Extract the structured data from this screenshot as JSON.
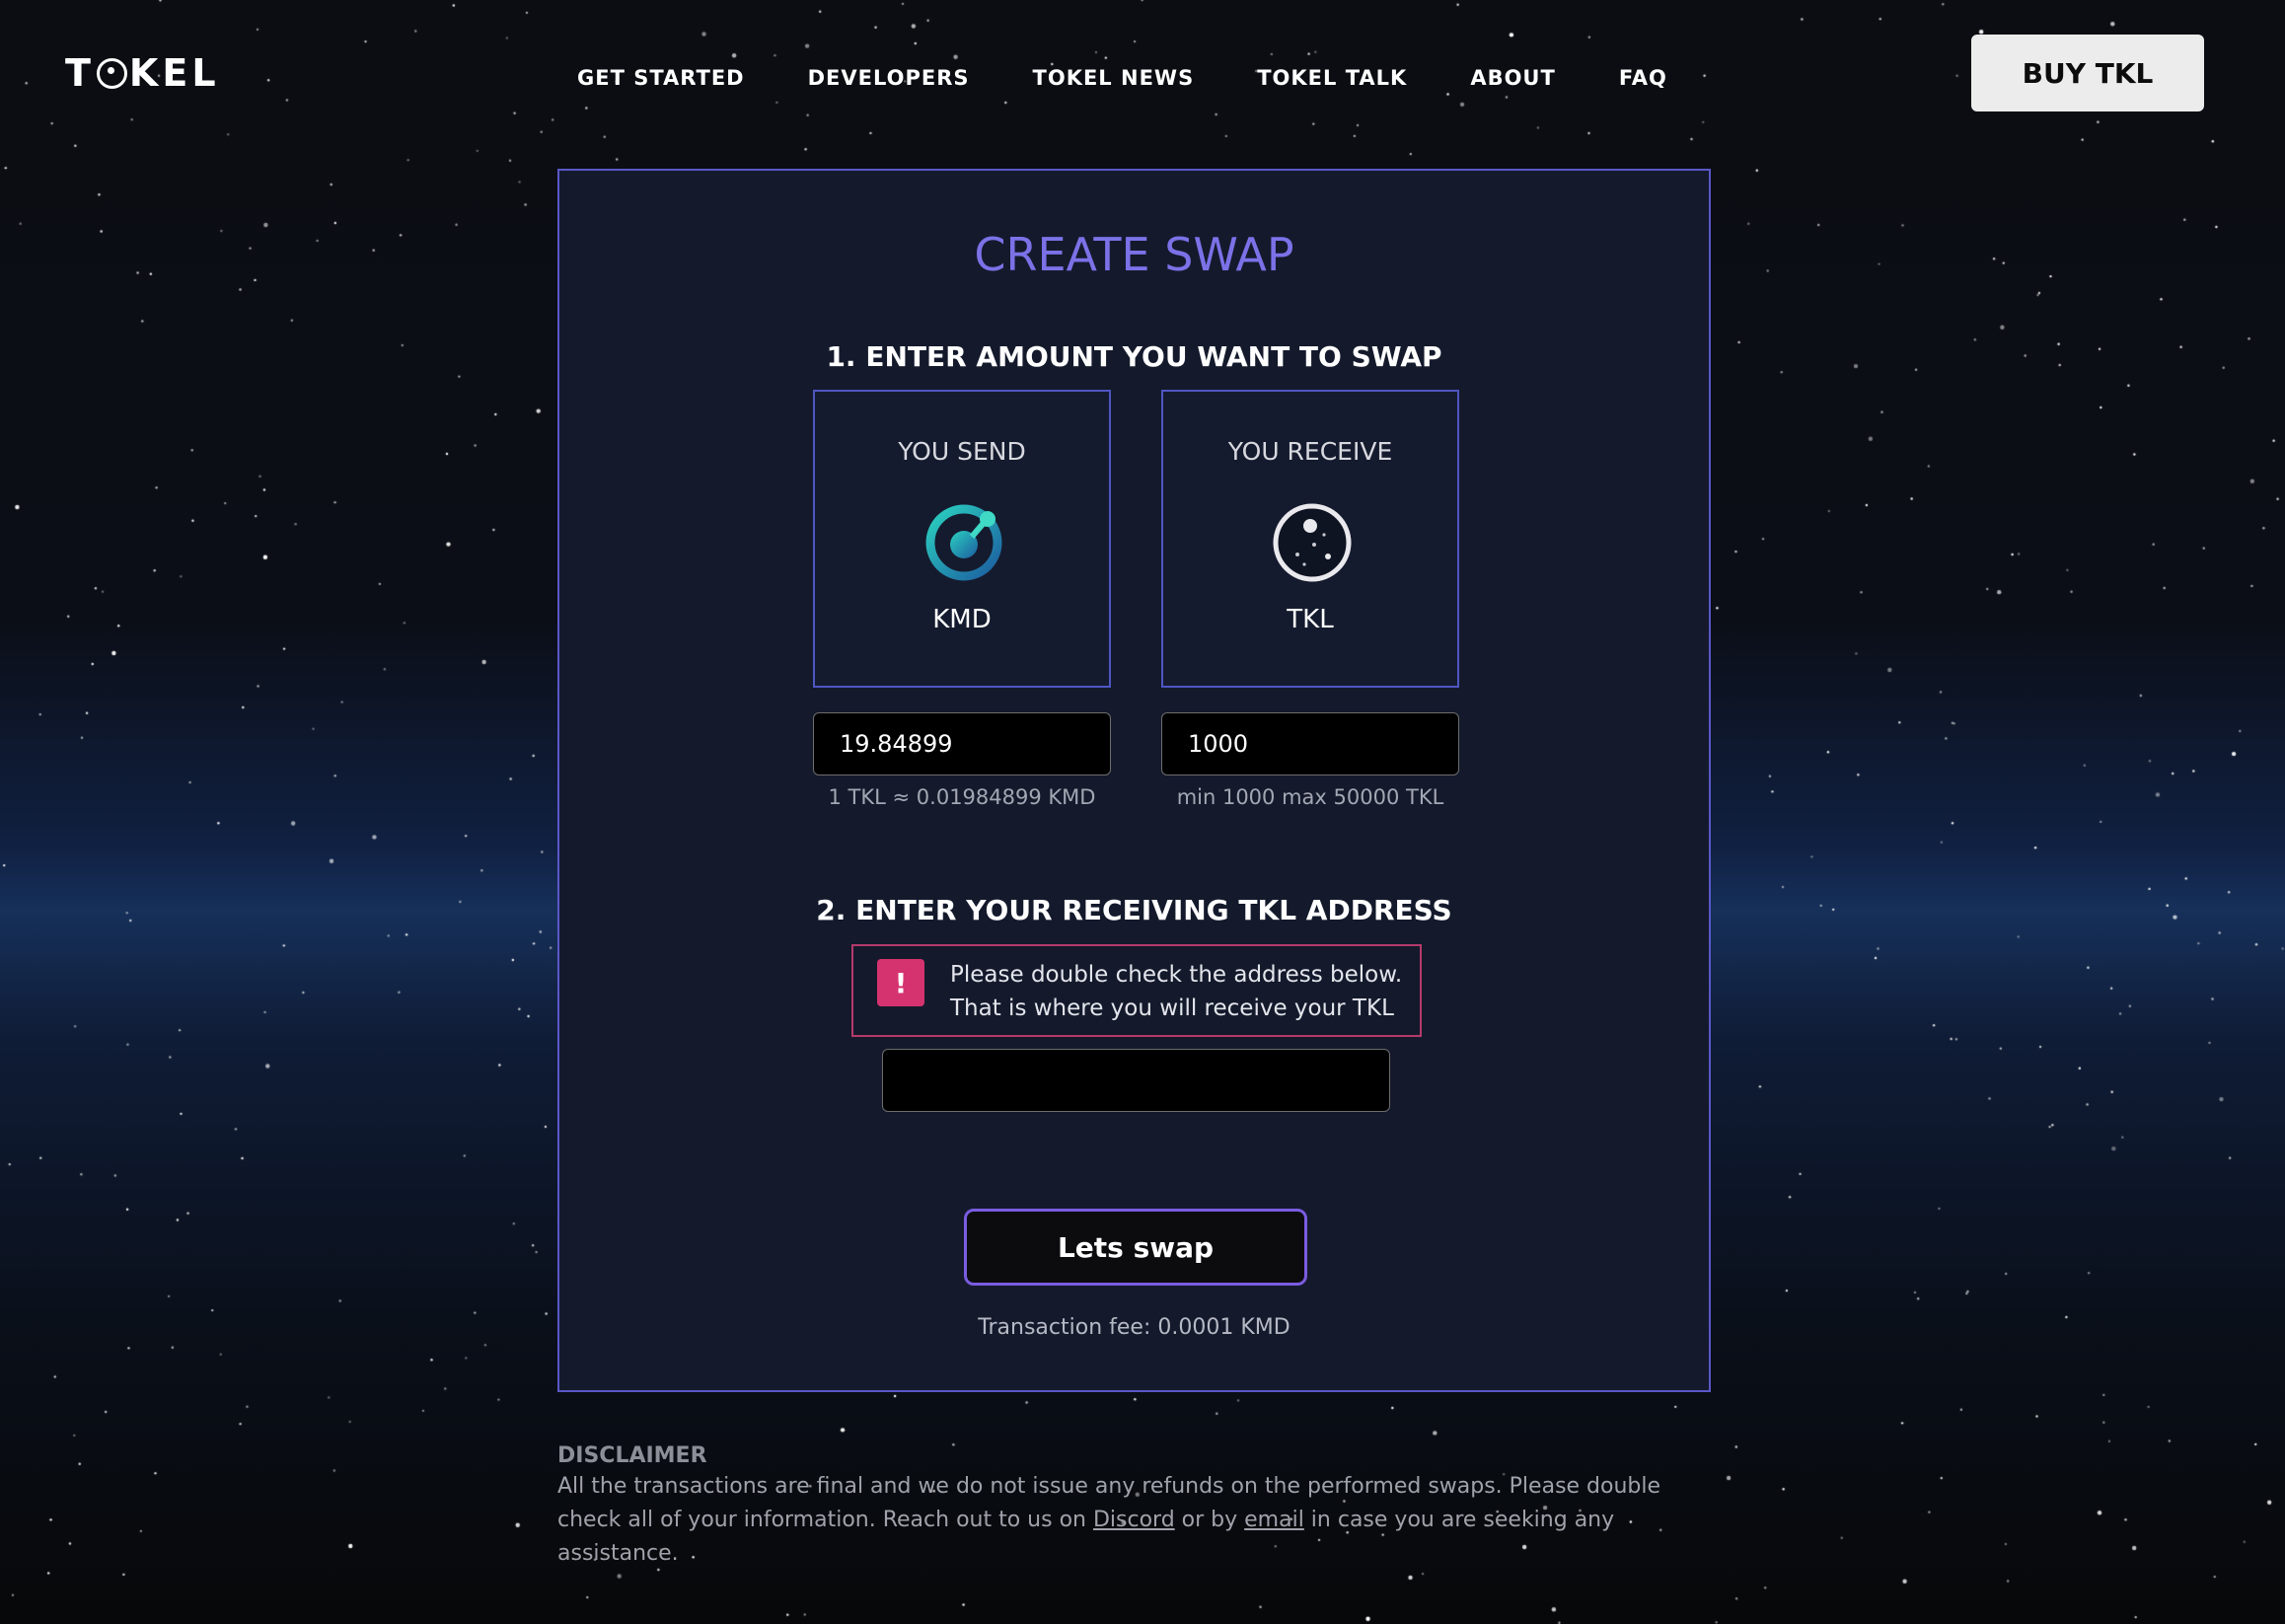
{
  "header": {
    "logo": "TOKEL",
    "nav": [
      "GET STARTED",
      "DEVELOPERS",
      "TOKEL NEWS",
      "TOKEL TALK",
      "ABOUT",
      "FAQ"
    ],
    "buy_button": "BUY TKL"
  },
  "swap": {
    "title": "CREATE SWAP",
    "step1": "1. ENTER AMOUNT YOU WANT TO SWAP",
    "send": {
      "label": "YOU SEND",
      "symbol": "KMD",
      "icon": "kmd-coin-icon",
      "amount": "19.84899",
      "hint": "1 TKL ≈ 0.01984899 KMD"
    },
    "receive": {
      "label": "YOU RECEIVE",
      "symbol": "TKL",
      "icon": "tkl-coin-icon",
      "amount": "1000",
      "hint": "min 1000 max 50000 TKL"
    },
    "step2": "2. ENTER YOUR RECEIVING TKL ADDRESS",
    "warning": {
      "icon": "!",
      "line1": "Please double check the address below.",
      "line2": "That is where you will receive your TKL"
    },
    "address_value": "",
    "submit": "Lets swap",
    "fee": "Transaction fee: 0.0001 KMD"
  },
  "disclaimer": {
    "title": "DISCLAIMER",
    "text_1": "All the transactions are final and we do not issue any refunds on the performed swaps. Please double check all of your information. Reach out to us on ",
    "link_discord": "Discord",
    "text_2": " or by ",
    "link_email": "email",
    "text_3": " in case you are seeking any assistance."
  },
  "colors": {
    "accent": "#7b72e8",
    "card_border": "#5a58c8",
    "warning": "#d5336f",
    "swap_border": "#7a5ce0"
  }
}
